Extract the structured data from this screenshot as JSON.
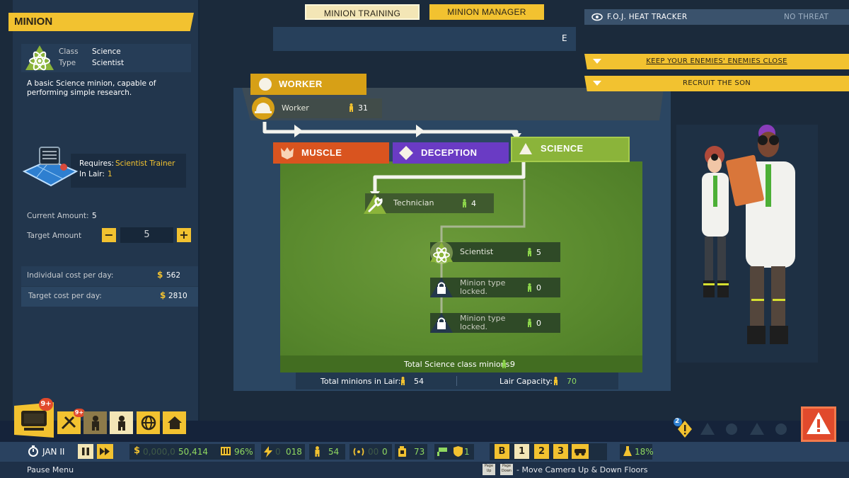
{
  "left_panel": {
    "title": "MINION",
    "class_label": "Class",
    "class_value": "Science",
    "type_label": "Type",
    "type_value": "Scientist",
    "description": "A basic Science minion, capable of performing simple research.",
    "requires_label": "Requires:",
    "requires_value": "Scientist Trainer",
    "in_lair_label": "In Lair:",
    "in_lair_value": "1",
    "current_amount_label": "Current Amount:",
    "current_amount_value": "5",
    "target_amount_label": "Target Amount",
    "target_amount_value": "5",
    "minus": "−",
    "plus": "+",
    "individual_cost_label": "Individual cost per day:",
    "individual_cost_value": "562",
    "target_cost_label": "Target cost per day:",
    "target_cost_value": "2810",
    "currency_symbol": "$"
  },
  "tabs": {
    "training": "MINION TRAINING",
    "manager": "MINION MANAGER",
    "key_hint": "E"
  },
  "tree": {
    "worker_tab": "WORKER",
    "worker_node": {
      "name": "Worker",
      "count": "31"
    },
    "muscle_tab": "MUSCLE",
    "deception_tab": "DECEPTION",
    "science_tab": "SCIENCE",
    "technician": {
      "name": "Technician",
      "count": "4"
    },
    "scientist": {
      "name": "Scientist",
      "count": "5"
    },
    "locked1": {
      "name": "Minion type locked.",
      "count": "0"
    },
    "locked2": {
      "name": "Minion type locked.",
      "count": "0"
    },
    "total_class_label": "Total Science class minions:",
    "total_class_value": "9",
    "total_lair_label": "Total minions in Lair:",
    "total_lair_value": "54",
    "capacity_label": "Lair Capacity:",
    "capacity_value": "70"
  },
  "right": {
    "heat_title": "F.O.J. HEAT TRACKER",
    "heat_status": "NO THREAT",
    "objective1": "KEEP YOUR ENEMIES' ENEMIES CLOSE",
    "objective2": "RECRUIT THE SON"
  },
  "bottom": {
    "badge_tv": "9+",
    "badge_tools": "9+",
    "date": "JAN II",
    "money_dim": "0,000,0",
    "money": "50,414",
    "percent1": "96%",
    "power_dim": "0",
    "power": "018",
    "minions": "54",
    "signal_dim": "00",
    "signal": "0",
    "fuel": "73",
    "shield": "1",
    "floors": [
      "B",
      "1",
      "2",
      "3"
    ],
    "science_pct": "18%",
    "alert_badge": "2",
    "pause_menu": "Pause Menu",
    "page_up": "Page Up",
    "page_down": "Page Down",
    "camera_hint": "- Move Camera Up & Down Floors"
  },
  "colors": {
    "accent_yellow": "#f2c230",
    "muscle_orange": "#d9541f",
    "deception_purple": "#6a3bc4",
    "science_green": "#8bb43a",
    "panel_blue": "#22364d",
    "alert_red": "#e14a2c",
    "value_green": "#8fd860"
  },
  "icons": {
    "science": "atom-icon",
    "worker": "hardhat-icon",
    "technician": "wrench-icon",
    "locked": "lock-icon",
    "minion": "minion-figure-icon",
    "alert": "warning-icon"
  }
}
